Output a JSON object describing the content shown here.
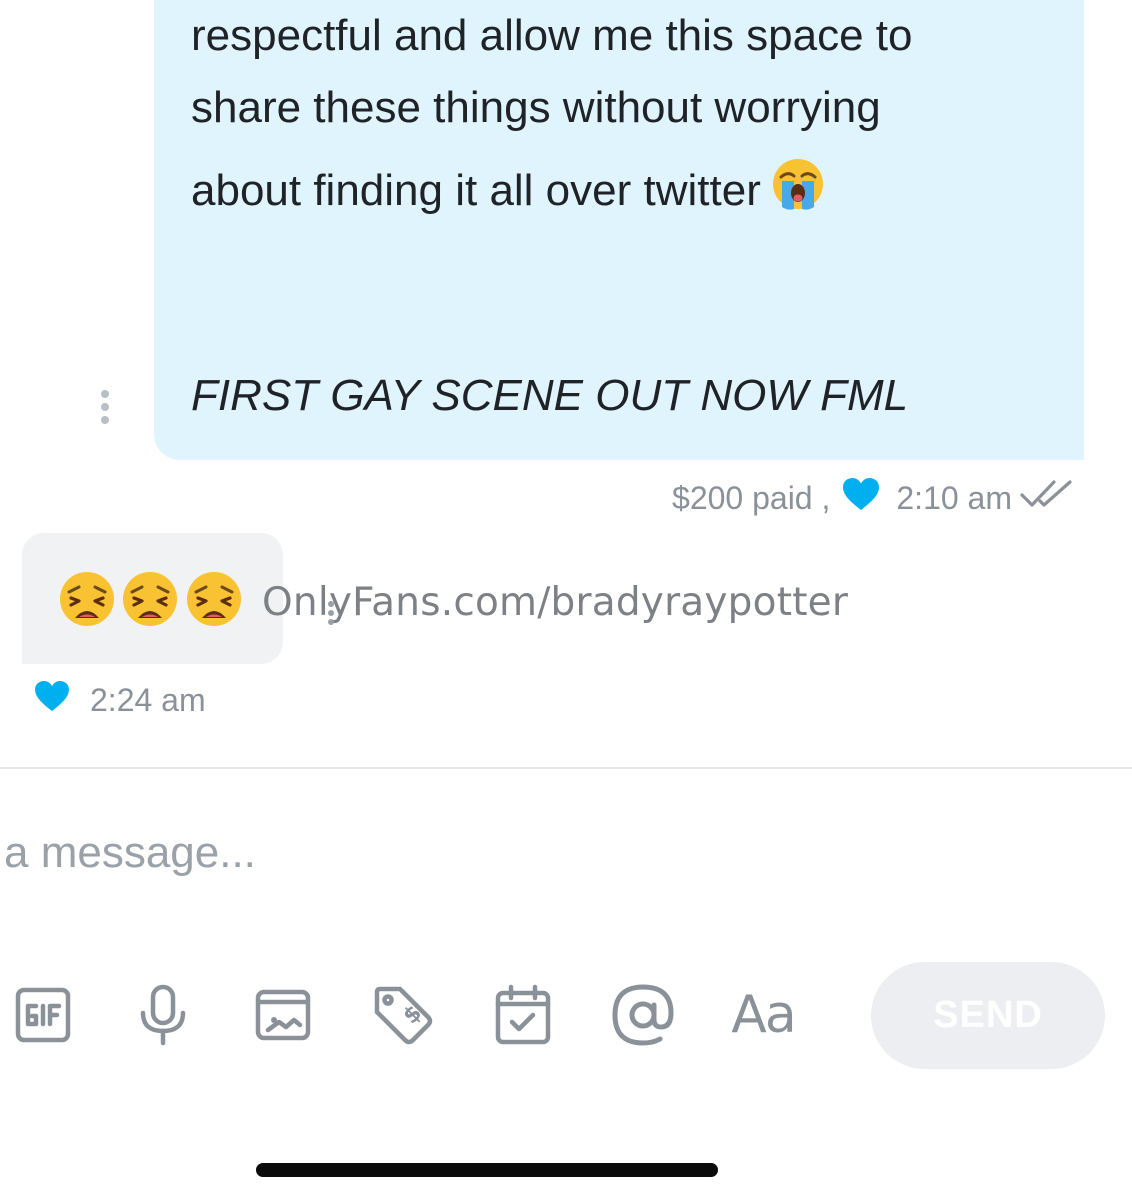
{
  "colors": {
    "outgoing_bubble": "#dff4fd",
    "incoming_bubble": "#f1f2f4",
    "accent_heart": "#00aff0",
    "muted_text": "#8a9199"
  },
  "messages": {
    "outgoing": {
      "lines": [
        "respectful and allow me this space to",
        "share these things without worrying",
        "about finding it all over twitter",
        "FIRST GAY SCENE OUT NOW FML"
      ],
      "inline_emoji": "loudly-crying-face-emoji",
      "price": "$200 paid ,",
      "liked": true,
      "time": "2:10 am",
      "read_status": "double-check-icon"
    },
    "incoming": {
      "emojis": [
        "weary-face-emoji",
        "weary-face-emoji",
        "weary-face-emoji"
      ],
      "liked": true,
      "time": "2:24 am"
    }
  },
  "watermark": "OnlyFans.com/bradyraypotter",
  "composer": {
    "placeholder": "a message...",
    "value": "",
    "tools": [
      "gif-icon",
      "microphone-icon",
      "image-icon",
      "price-tag-icon",
      "calendar-icon",
      "at-mention-icon",
      "text-format-icon"
    ],
    "text_format_label": "Aa",
    "send_label": "SEND"
  }
}
